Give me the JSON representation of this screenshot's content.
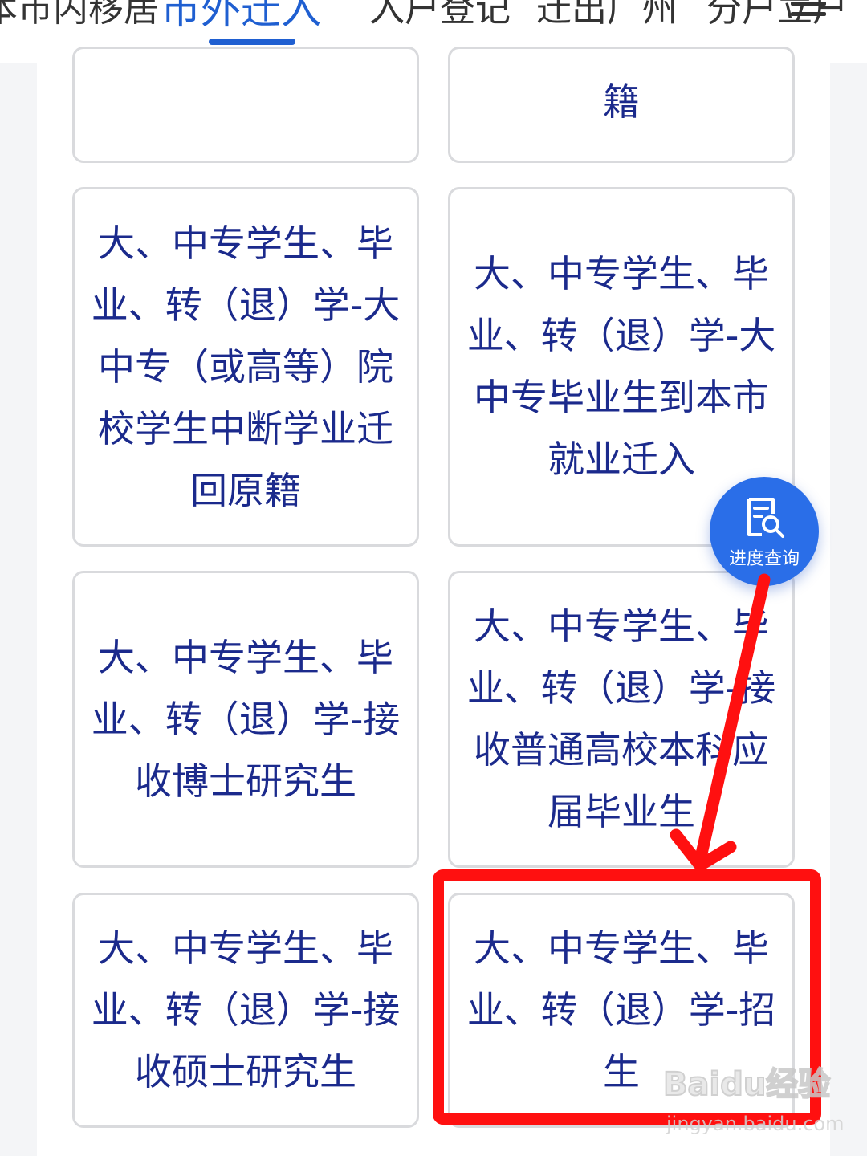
{
  "tabs": [
    {
      "label": "本市内移居",
      "active": false
    },
    {
      "label": "市外迁入",
      "active": true
    },
    {
      "label": "入户登记",
      "active": false
    },
    {
      "label": "迁出广州",
      "active": false
    },
    {
      "label": "分户立户",
      "active": false
    }
  ],
  "cards": [
    {
      "label": ""
    },
    {
      "label": "籍"
    },
    {
      "label": "大、中专学生、毕业、转（退）学-大中专（或高等）院校学生中断学业迁回原籍"
    },
    {
      "label": "大、中专学生、毕业、转（退）学-大中专毕业生到本市就业迁入"
    },
    {
      "label": "大、中专学生、毕业、转（退）学-接收博士研究生"
    },
    {
      "label": "大、中专学生、毕业、转（退）学-接收普通高校本科应届毕业生"
    },
    {
      "label": "大、中专学生、毕业、转（退）学-接收硕士研究生"
    },
    {
      "label": "大、中专学生、毕业、转（退）学-招生"
    }
  ],
  "fab": {
    "label": "进度查询",
    "icon": "document-search-icon"
  },
  "annotation": {
    "color": "#ff1010"
  },
  "watermark": {
    "brand": "Baidu经验",
    "url": "jingyan.baidu.com"
  },
  "colors": {
    "accent": "#1f5fd1",
    "card_text": "#1b2a8c",
    "fab": "#2a6ee8",
    "card_border": "#d9dadd"
  }
}
